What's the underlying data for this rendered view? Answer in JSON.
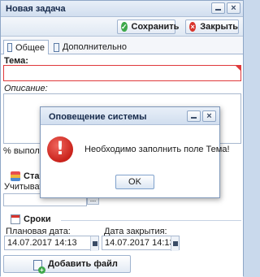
{
  "window": {
    "title": "Новая задача"
  },
  "toolbar": {
    "save_label": "Сохранить",
    "close_label": "Закрыть"
  },
  "tabs": [
    {
      "label": "Общее",
      "active": true
    },
    {
      "label": "Дополнительно",
      "active": false
    }
  ],
  "form": {
    "topic_label": "Тема:",
    "topic_value": "",
    "description_label": "Описание:",
    "progress_label": "% выполнения",
    "status_section_label": "Статус",
    "consider_label": "Учитывать",
    "consider_button": "...",
    "dates_section_label": "Сроки",
    "planned_date_label": "Плановая дата:",
    "planned_date_value": "14.07.2017 14:13",
    "close_date_label": "Дата закрытия:",
    "close_date_value": "14.07.2017 14:13",
    "add_file_label": "Добавить файл"
  },
  "dialog": {
    "title": "Оповещение системы",
    "message": "Необходимо заполнить поле Тема!",
    "ok_label": "OK",
    "icon": "error-icon",
    "icon_glyph": "!"
  },
  "colors": {
    "error": "#e0393b",
    "accent": "#3ea84a",
    "close": "#d9352c"
  }
}
